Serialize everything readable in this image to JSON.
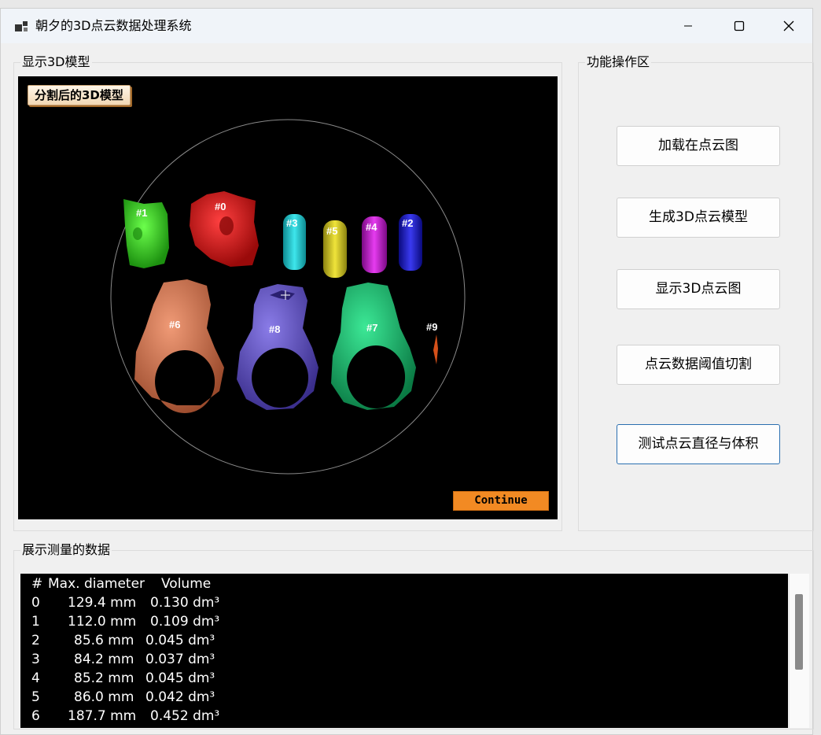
{
  "window": {
    "title": "朝夕的3D点云数据处理系统"
  },
  "view_panel": {
    "label": "显示3D模型",
    "viewport_title": "分割后的3D模型",
    "continue_label": "Continue",
    "object_labels": [
      {
        "id": "obj-0",
        "text": "#0",
        "color": "#e21414"
      },
      {
        "id": "obj-1",
        "text": "#1",
        "color": "#2fd21c"
      },
      {
        "id": "obj-2",
        "text": "#2",
        "color": "#1414c8"
      },
      {
        "id": "obj-3",
        "text": "#3",
        "color": "#19c2c8"
      },
      {
        "id": "obj-4",
        "text": "#4",
        "color": "#b414c0"
      },
      {
        "id": "obj-5",
        "text": "#5",
        "color": "#c2b814"
      },
      {
        "id": "obj-6",
        "text": "#6",
        "color": "#d0704c"
      },
      {
        "id": "obj-7",
        "text": "#7",
        "color": "#10b466"
      },
      {
        "id": "obj-8",
        "text": "#8",
        "color": "#5a4cc0"
      },
      {
        "id": "obj-9",
        "text": "#9",
        "color": "#d4501a"
      }
    ]
  },
  "ops_panel": {
    "label": "功能操作区",
    "buttons": [
      {
        "id": "load",
        "label": "加载在点云图"
      },
      {
        "id": "generate",
        "label": "生成3D点云模型"
      },
      {
        "id": "show",
        "label": "显示3D点云图"
      },
      {
        "id": "threshold",
        "label": "点云数据阈值切割"
      },
      {
        "id": "measure",
        "label": "测试点云直径与体积"
      }
    ]
  },
  "data_panel": {
    "label": "展示测量的数据",
    "header": {
      "index": "#",
      "diameter": "Max. diameter",
      "volume": "Volume"
    },
    "rows": [
      {
        "index": "0",
        "diameter": "129.4 mm",
        "volume": "0.130 dm³"
      },
      {
        "index": "1",
        "diameter": "112.0 mm",
        "volume": "0.109 dm³"
      },
      {
        "index": "2",
        "diameter": "85.6 mm",
        "volume": "0.045 dm³"
      },
      {
        "index": "3",
        "diameter": "84.2 mm",
        "volume": "0.037 dm³"
      },
      {
        "index": "4",
        "diameter": "85.2 mm",
        "volume": "0.045 dm³"
      },
      {
        "index": "5",
        "diameter": "86.0 mm",
        "volume": "0.042 dm³"
      },
      {
        "index": "6",
        "diameter": "187.7 mm",
        "volume": "0.452 dm³"
      }
    ]
  }
}
